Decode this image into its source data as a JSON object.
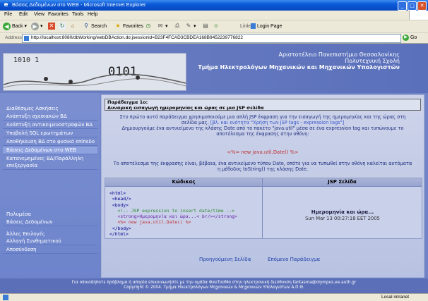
{
  "window": {
    "title": "Βάσεις Δεδομένων στο WEB - Microsoft Internet Explorer",
    "min": "_",
    "max": "□",
    "close": "✕"
  },
  "menu": [
    "File",
    "Edit",
    "View",
    "Favorites",
    "Tools",
    "Help"
  ],
  "toolbar": {
    "back": "Back",
    "search": "Search",
    "favorites": "Favorites",
    "links": "Links",
    "login": "Login Page"
  },
  "address": {
    "label": "Address",
    "url": "http://localhost:8080/dbWorking/webDBAction.do;jsessionid=B23F4FCAD3CBDEA168B9452239776822",
    "go": "Go"
  },
  "banner": {
    "line1": "Αριστοτέλειο Πανεπιστήμιο Θεσσαλονίκης",
    "line2": "Πολυτεχνική Σχολή",
    "line3": "Τμήμα Ηλεκτρολόγων Μηχανικών και Μηχανικών Υπολογιστών",
    "img_bin": "1010 1",
    "img_bin2": "0101"
  },
  "sidebar": {
    "heading1": "Διαθέσιμες Ασκήσεις",
    "items": [
      "Ανάπτυξη σχεσιακών ΒΔ",
      "Ανάπτυξη αντικειμενοστραφών ΒΔ",
      "Υποβολή SQL ερωτημάτων",
      "Αποθήκευση ΒΔ στο φυσικό επίπεδο",
      "Βάσεις Δεδομένων στο WEB",
      "Κατανεμημένες ΒΔ/Παράλληλη",
      "επεξεργασία"
    ],
    "heading2": "Πολυμέσα",
    "item_b": "Βάσεις Δεδομένων",
    "heading3": "Άλλες Επιλογές",
    "items2": [
      "Αλλαγή Συνθηματικού",
      "Αποσύνδεση"
    ]
  },
  "example": {
    "title1": "Παράδειγμα 1ο:",
    "title2": "Δυναμική εισαγωγή ημερομηνίας και ώρας σε μια JSP σελίδα",
    "p1a": "Στο πρώτο αυτό παράδειγμα χρησιμοποιούμε μια απλή JSP έκφραση για την εισαγωγή της ημερομηνίας και της ώρας στη",
    "p1b": "σελίδα μας.",
    "p1link": "[βλ. και ενότητα \"Χρήση των JSP tags - expression tags\"]",
    "p1c": "Δημιουργούμε ένα αντικείμενο της κλάσης Date από το πακέτο \"java.util\" μέσα σε ένα expression tag και τυπώνουμε το",
    "p1d": "αποτέλεσμα της έκφρασης στην οθόνη:",
    "expr": "<%= new java.util.Date() %>",
    "p2a": "Το αποτέλεσμα της έκφρασης είναι, βέβαια, ένα αντικείμενο τύπου Date, οπότε για να τυπωθεί στην οθόνη καλείται αυτόματα",
    "p2b": "η μέθοδος toString() της κλάσης Date."
  },
  "table": {
    "col1": "Κώδικας",
    "col2": "JSP Σελίδα",
    "code": [
      "<html>",
      " <head/>",
      " <body>",
      "   <!-- JSP expression to insert date/time -->",
      "   <strong>Ημερομηνία και ώρα...< br/></strong>",
      "   <%= new java.util.Date() %>",
      " </body>",
      "</html>"
    ],
    "result_title": "Ημερομηνία και ώρα...",
    "result_value": "Sun Mar 13 00:27:18 EET 2005"
  },
  "nav": {
    "prev": "Προηγούμενη Σελίδα",
    "next": "Επόμενο Παράδειγμα"
  },
  "footer": {
    "line1": "Για οποιοδήποτε πρόβλημα ή απορία επικοινωνήστε με την ομάδα ΦανΤοσΜα στην ηλεκτρονική διεύθυνση fantasma@olympus.ee.auth.gr",
    "line2": "Copyright © 2004. Τμήμα Ηλεκτρολόγων Μηχανικών & Μηχανικών Υπολογιστών Α.Π.Θ."
  },
  "status": {
    "zone": "Local intranet"
  }
}
